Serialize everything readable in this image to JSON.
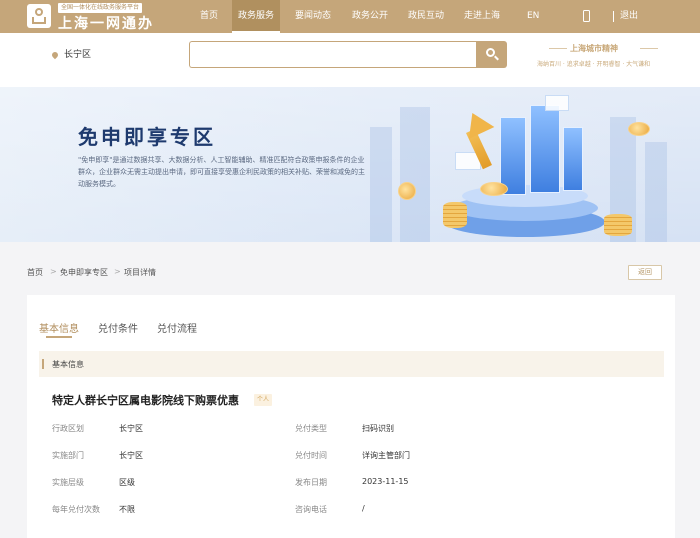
{
  "header": {
    "platform_tag": "全国一体化在线政务服务平台",
    "site_title": "上海一网通办",
    "nav": [
      "首页",
      "政务服务",
      "要闻动态",
      "政务公开",
      "政民互动",
      "走进上海",
      "EN"
    ],
    "nav_active": "政务服务",
    "exit_label": "退出"
  },
  "location": {
    "district": "长宁区"
  },
  "search": {
    "placeholder": ""
  },
  "spirit": {
    "title": "上海城市精神",
    "subtitle": "海纳百川 · 追求卓越 · 开明睿智 · 大气谦和"
  },
  "banner": {
    "title": "免申即享专区",
    "description": "\"免申即享\"是通过数据共享、大数据分析、人工智能辅助、精准匹配符合政策申报条件的企业群众，企业群众无需主动提出申请，即可直接享受惠企利民政策的相关补贴、荣誉和减免的主动服务模式。"
  },
  "breadcrumb": {
    "items": [
      "首页",
      "免申即享专区",
      "项目详情"
    ],
    "back_label": "返回"
  },
  "tabs": [
    "基本信息",
    "兑付条件",
    "兑付流程"
  ],
  "tab_active": "基本信息",
  "section": {
    "title": "基本信息"
  },
  "item": {
    "title": "特定人群长宁区属电影院线下购票优惠",
    "badge": "个人",
    "fields": {
      "admin_region": {
        "label": "行政区划",
        "value": "长宁区"
      },
      "dept": {
        "label": "实施部门",
        "value": "长宁区"
      },
      "level": {
        "label": "实施层级",
        "value": "区级"
      },
      "yearly_count": {
        "label": "每年兑付次数",
        "value": "不限"
      },
      "pay_type": {
        "label": "兑付类型",
        "value": "扫码识别"
      },
      "pay_time": {
        "label": "兑付时间",
        "value": "详询主管部门"
      },
      "publish_date": {
        "label": "发布日期",
        "value": "2023-11-15"
      },
      "phone": {
        "label": "咨询电话",
        "value": "/"
      }
    }
  },
  "colors": {
    "brand_gold": "#c5a67a",
    "nav_active_bg": "#b0905f",
    "banner_title": "#1e3a6e"
  }
}
